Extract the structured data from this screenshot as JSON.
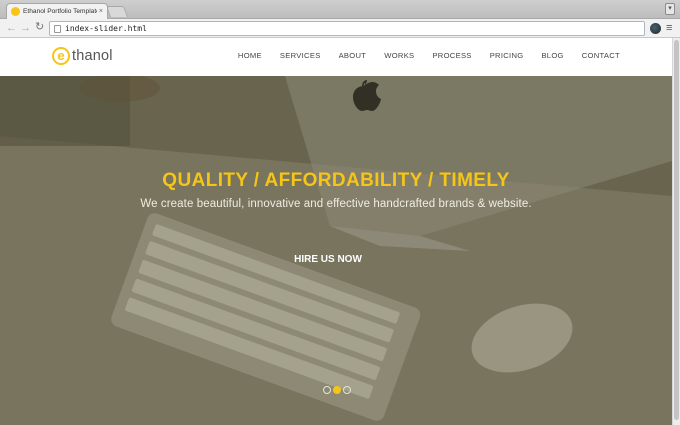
{
  "browser": {
    "tab_title": "Ethanol Portfolio Template",
    "tab_close": "×",
    "url": "index-slider.html",
    "back_glyph": "←",
    "forward_glyph": "→",
    "reload_glyph": "↻",
    "menu_glyph": "≡",
    "window_glyph": "▾",
    "accent": "#f5c518"
  },
  "site": {
    "logo_mark": "e",
    "logo_text": "thanol",
    "nav": [
      {
        "label": "HOME"
      },
      {
        "label": "SERVICES"
      },
      {
        "label": "ABOUT"
      },
      {
        "label": "WORKS"
      },
      {
        "label": "PROCESS"
      },
      {
        "label": "PRICING"
      },
      {
        "label": "BLOG"
      },
      {
        "label": "CONTACT"
      }
    ]
  },
  "hero": {
    "headline": "QUALITY / AFFORDABILITY / TIMELY",
    "subheadline": "We create beautiful, innovative and effective handcrafted brands & website.",
    "cta_label": "HIRE US NOW",
    "slides": 3,
    "active_slide": 2,
    "headline_color": "#f5c518"
  }
}
